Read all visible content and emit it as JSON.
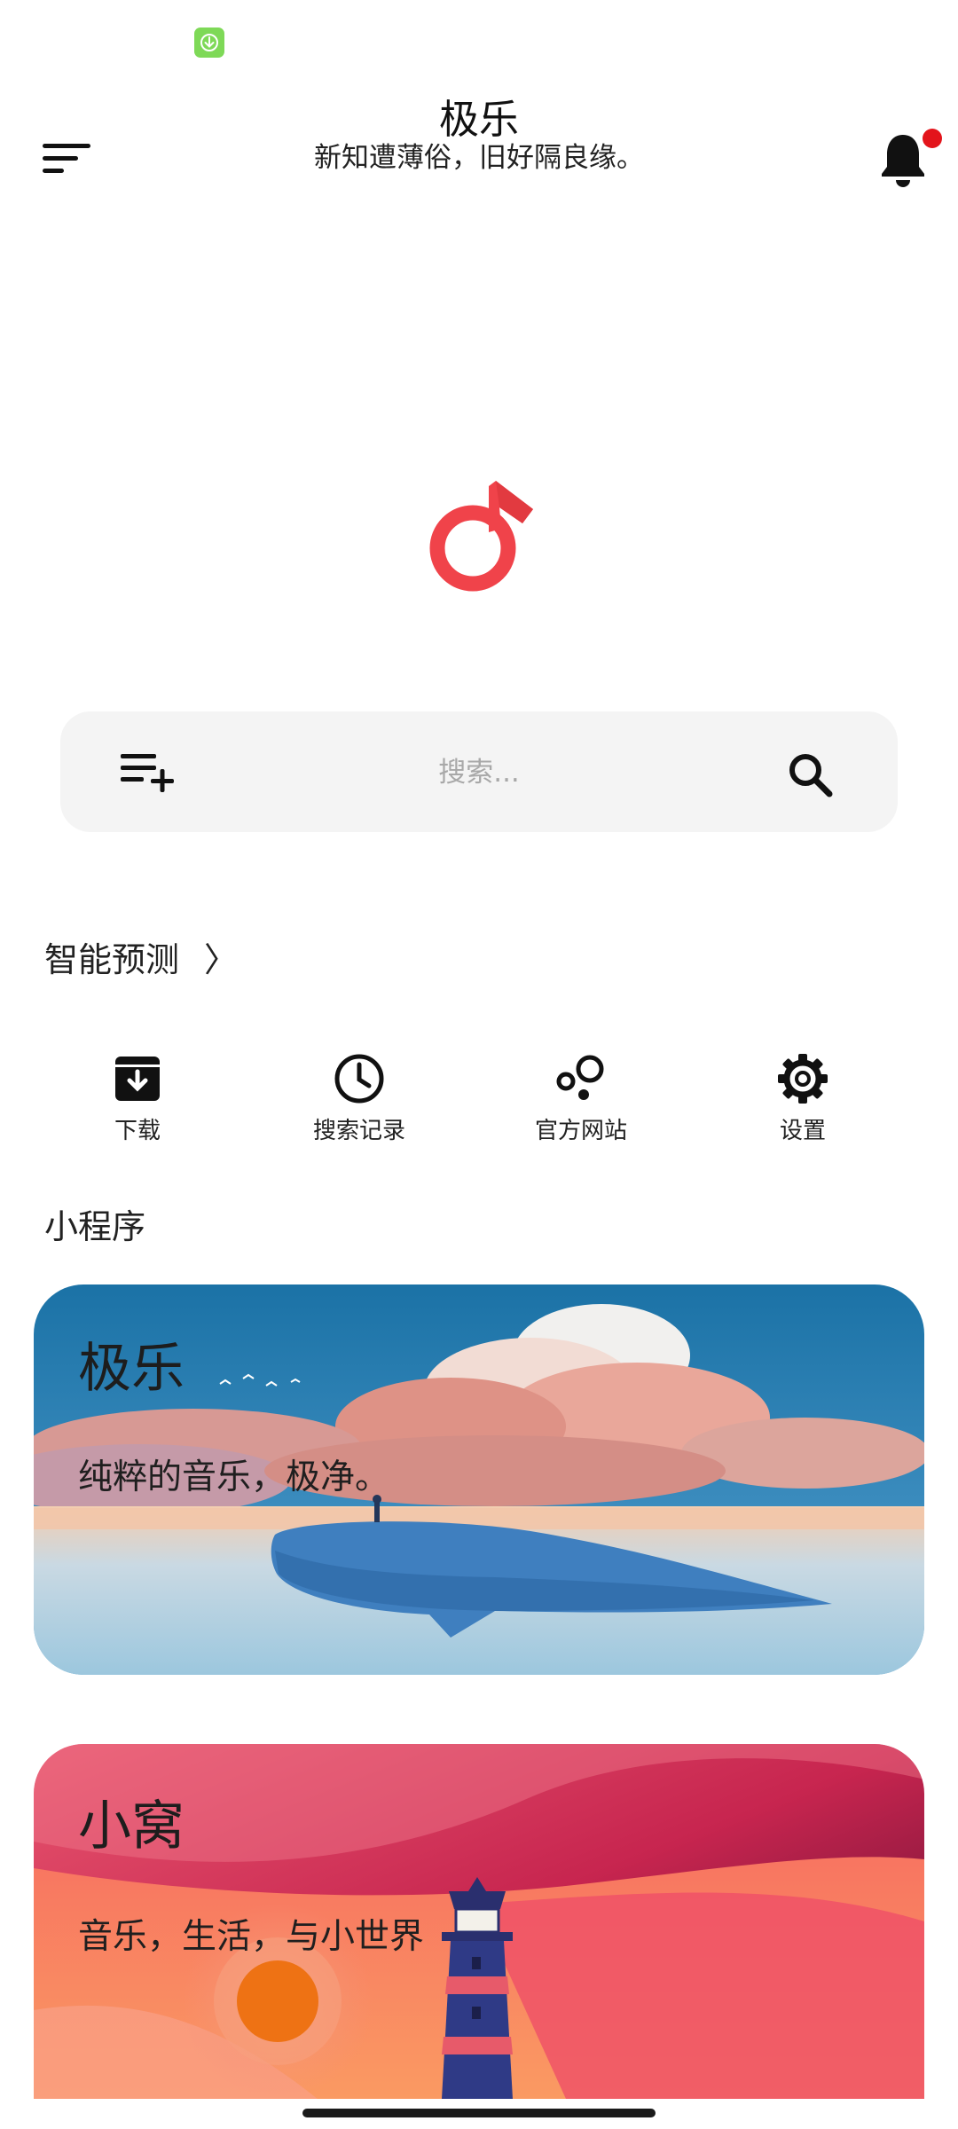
{
  "status_bar": {
    "download_badge_icon": "download-arrow-icon",
    "badge_color": "#7ed957"
  },
  "header": {
    "title": "极乐",
    "subtitle": "新知遭薄俗，旧好隔良缘。",
    "menu_icon": "menu-lines-icon",
    "notification_icon": "bell-icon",
    "notification_dot_color": "#e3141b"
  },
  "logo": {
    "icon": "music-note-logo-icon",
    "color": "#f0434a"
  },
  "search": {
    "placeholder": "搜索...",
    "left_icon": "playlist-add-icon",
    "right_icon": "search-icon"
  },
  "smart_predict": {
    "label": "智能预测",
    "chevron": "〉"
  },
  "quick_actions": [
    {
      "label": "下载",
      "icon": "download-box-icon"
    },
    {
      "label": "搜索记录",
      "icon": "clock-icon"
    },
    {
      "label": "官方网站",
      "icon": "bubbles-icon"
    },
    {
      "label": "设置",
      "icon": "gear-icon"
    }
  ],
  "mini_programs": {
    "section_title": "小程序",
    "cards": [
      {
        "title": "极乐",
        "description": "纯粹的音乐，极净。"
      },
      {
        "title": "小窝",
        "description": "音乐，生活，与小世界"
      }
    ]
  }
}
